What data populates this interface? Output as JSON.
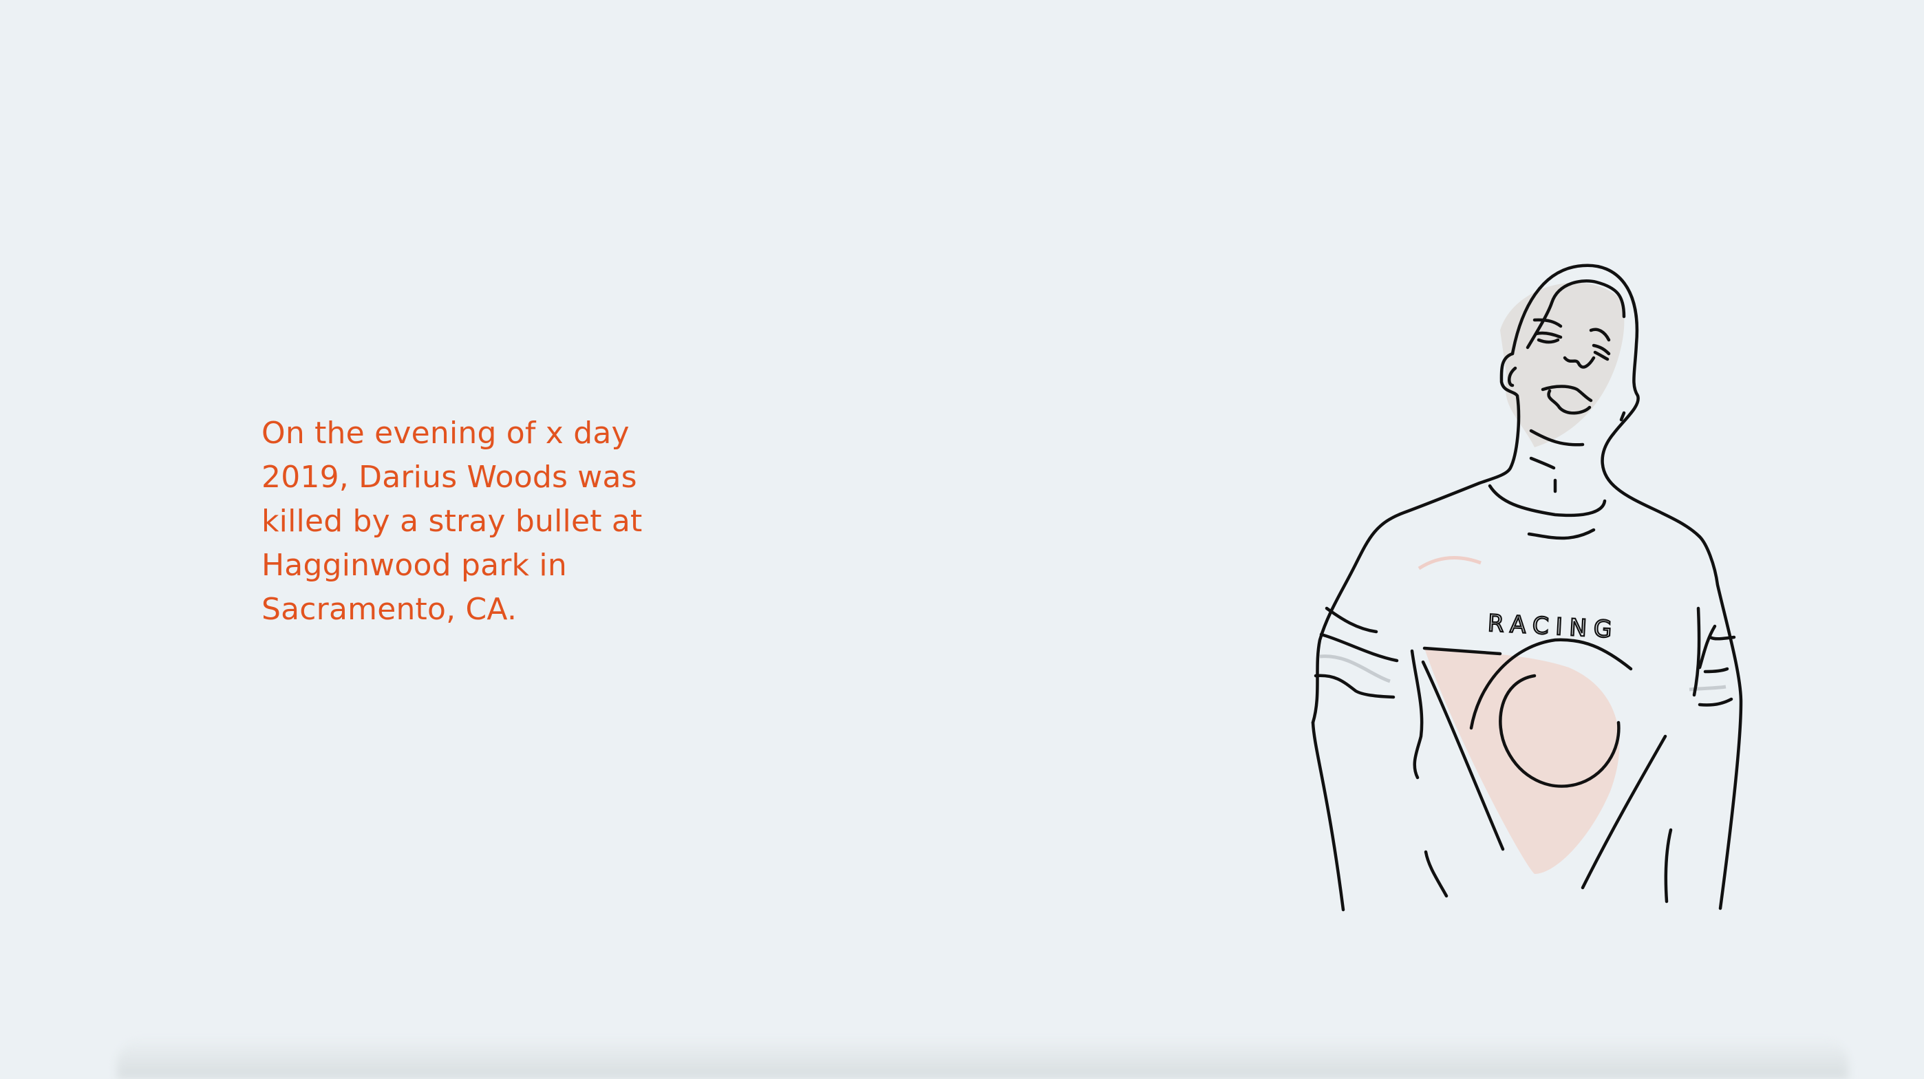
{
  "story": {
    "text": "On the evening of x day 2019, Darius Woods was killed by a stray bullet at Hagginwood park in Sacramento, CA."
  },
  "illustration": {
    "subject": "line-drawing-person-portrait",
    "shirt_text": "RACING",
    "colors": {
      "line": "#111111",
      "skin_fill": "#e2e0de",
      "shirt_fill": "#efdcd6",
      "accent": "#e2531f"
    }
  }
}
